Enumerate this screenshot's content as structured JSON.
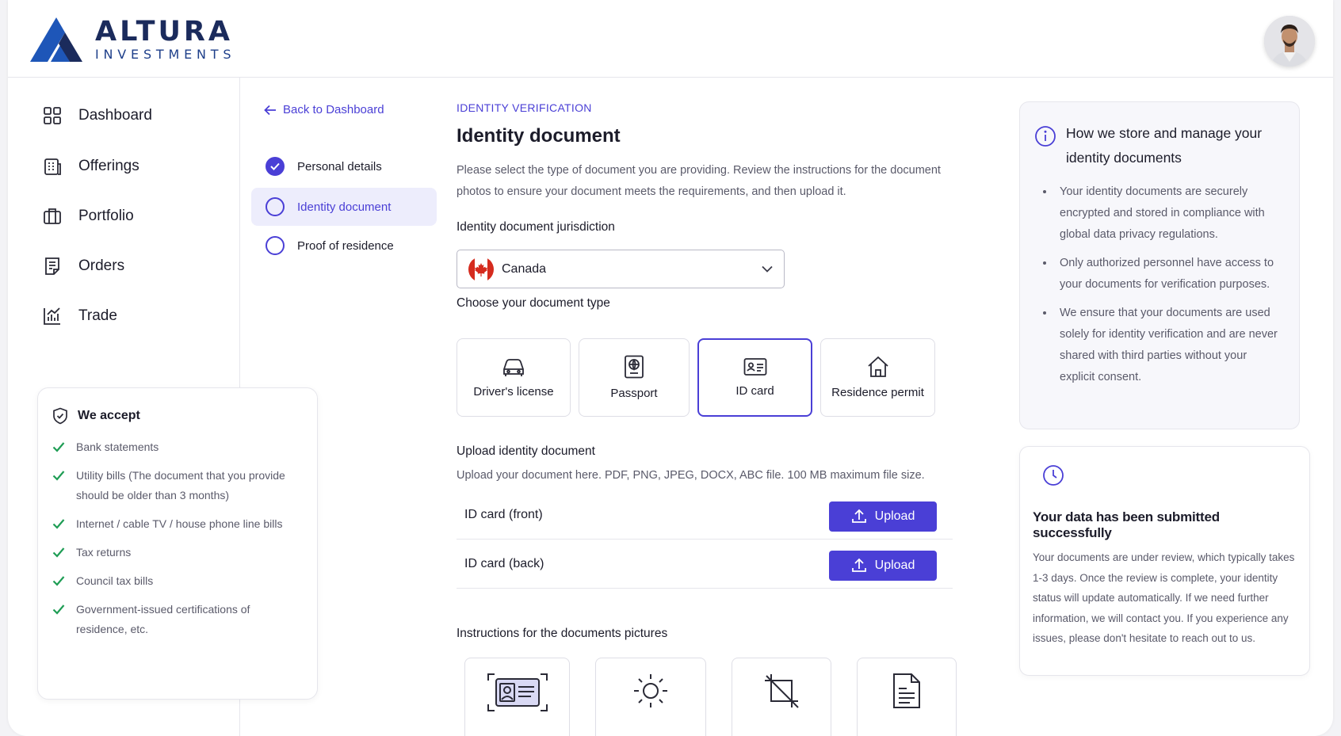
{
  "brand": {
    "name": "ALTURA",
    "tagline": "INVESTMENTS"
  },
  "sidebar": {
    "items": [
      {
        "label": "Dashboard",
        "icon": "grid-icon"
      },
      {
        "label": "Offerings",
        "icon": "building-icon"
      },
      {
        "label": "Portfolio",
        "icon": "briefcase-icon"
      },
      {
        "label": "Orders",
        "icon": "document-icon"
      },
      {
        "label": "Trade",
        "icon": "chart-icon"
      }
    ],
    "accept": {
      "title": "We accept",
      "items": [
        "Bank statements",
        "Utility bills (The document that you provide should be older than 3 months)",
        "Internet / cable TV / house phone line bills",
        "Tax returns",
        "Council tax bills",
        "Government-issued certifications of residence, etc."
      ]
    }
  },
  "steps": {
    "back_label": "Back to Dashboard",
    "items": [
      {
        "label": "Personal details",
        "state": "done"
      },
      {
        "label": "Identity document",
        "state": "active"
      },
      {
        "label": "Proof of residence",
        "state": "pending"
      }
    ]
  },
  "main": {
    "eyebrow": "IDENTITY VERIFICATION",
    "title": "Identity document",
    "description": "Please select the type of document you are providing. Review the instructions for the document photos to ensure your document meets the requirements, and then upload it.",
    "jurisdiction_label": "Identity document jurisdiction",
    "jurisdiction_value": "Canada",
    "doctype_label": "Choose your document type",
    "doctypes": [
      {
        "label": "Driver's license",
        "icon": "car-icon",
        "selected": false
      },
      {
        "label": "Passport",
        "icon": "passport-icon",
        "selected": false
      },
      {
        "label": "ID card",
        "icon": "id-card-icon",
        "selected": true
      },
      {
        "label": "Residence permit",
        "icon": "house-icon",
        "selected": false
      }
    ],
    "upload_title": "Upload identity document",
    "upload_subtitle": "Upload your document here. PDF, PNG, JPEG, DOCX, ABC file. 100 MB maximum file size.",
    "uploads": [
      {
        "label": "ID card (front)",
        "button": "Upload"
      },
      {
        "label": "ID card (back)",
        "button": "Upload"
      }
    ],
    "instructions_title": "Instructions for the documents pictures"
  },
  "info": {
    "title": "How we store and manage your identity documents",
    "items": [
      "Your identity documents are securely encrypted and stored in compliance with global data privacy regulations.",
      "Only authorized personnel have access to your documents for verification purposes.",
      "We ensure that your documents are used solely for identity verification and are never shared with third parties without your explicit consent."
    ]
  },
  "success": {
    "title": "Your data has been submitted successfully",
    "body": "Your documents are under review, which typically takes 1-3 days. Once the review is complete, your identity status will update automatically. If we need further information, we will contact you. If you experience any issues, please don't hesitate to reach out to us."
  },
  "colors": {
    "accent": "#4a3fd6",
    "brand_dark": "#1b2b5c",
    "brand_blue": "#1e56b8",
    "check_green": "#1f9d55"
  }
}
